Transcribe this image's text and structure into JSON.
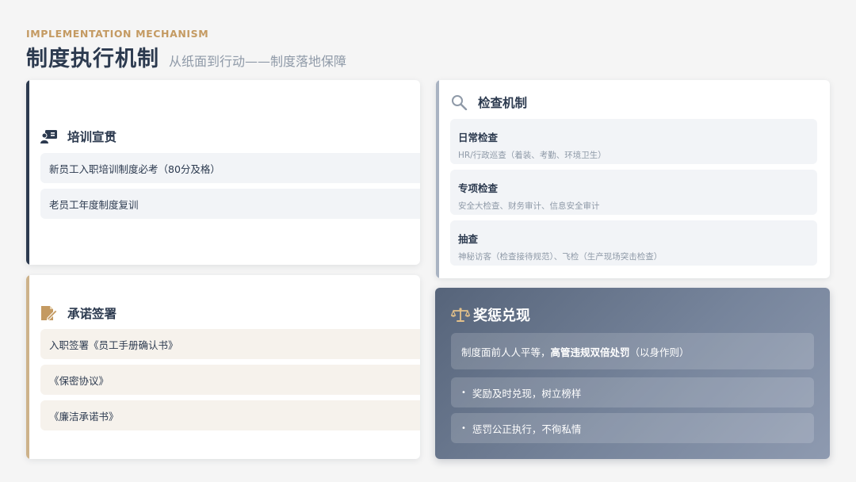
{
  "header": {
    "eyebrow": "IMPLEMENTATION MECHANISM",
    "title": "制度执行机制",
    "subtitle": "从纸面到行动——制度落地保障"
  },
  "colors": {
    "navy": "#2c3a4f",
    "gold": "#c49a62",
    "beige_accent": "#cdb28a",
    "gray_accent": "#a9b3c2"
  },
  "training": {
    "icon": "presentation-icon",
    "label": "培训宣贯",
    "items": [
      "新员工入职培训制度必考（80分及格）",
      "老员工年度制度复训"
    ]
  },
  "pledge": {
    "icon": "signature-icon",
    "label": "承诺签署",
    "items": [
      "入职签署《员工手册确认书》",
      "《保密协议》",
      "《廉洁承诺书》"
    ]
  },
  "inspection": {
    "icon": "search-icon",
    "label": "检查机制",
    "blocks": [
      {
        "title": "日常检查",
        "desc": "HR/行政巡查（着装、考勤、环境卫生）"
      },
      {
        "title": "专项检查",
        "desc": "安全大检查、财务审计、信息安全审计"
      },
      {
        "title": "抽查",
        "desc": "神秘访客（检查接待规范）、飞检（生产现场突击检查）"
      }
    ]
  },
  "reward": {
    "icon": "scale-icon",
    "label": "奖惩兑现",
    "principle_pre": "制度面前人人平等，",
    "principle_bold": "高管违规双倍处罚",
    "principle_post": "（以身作则）",
    "bullets": [
      "奖励及时兑现，树立榜样",
      "惩罚公正执行，不徇私情"
    ]
  }
}
